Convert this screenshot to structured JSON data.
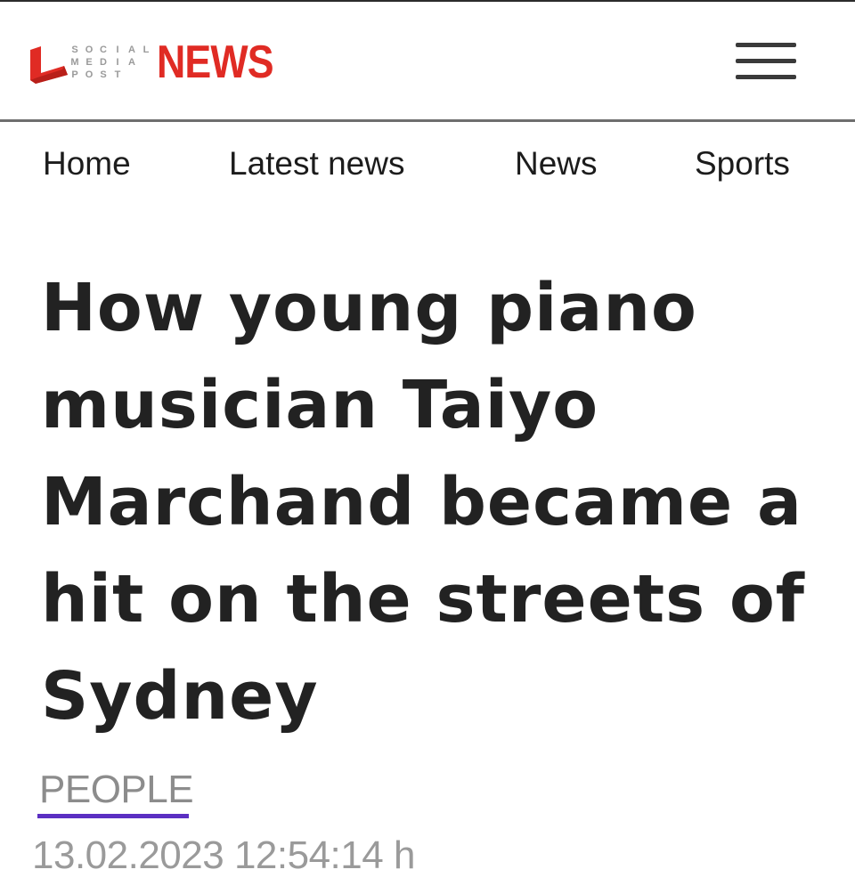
{
  "header": {
    "logo": {
      "letters": [
        "S",
        "O",
        "C",
        "I",
        "A",
        "L",
        "M",
        "E",
        "D",
        "I",
        "A",
        "",
        "P",
        "O",
        "S",
        "T",
        "",
        ""
      ],
      "wordmark": "NEWS",
      "brand_color": "#e02b24",
      "letters_color": "#9a9a9a"
    },
    "menu_icon": "hamburger-menu-icon"
  },
  "nav": {
    "items": [
      {
        "label": "Home"
      },
      {
        "label": "Latest news"
      },
      {
        "label": "News"
      },
      {
        "label": "Sports"
      }
    ]
  },
  "article": {
    "headline": "How young piano musician Taiyo Marchand became a hit on the streets of Sydney",
    "category": "PEOPLE",
    "category_accent": "#5b2fc2",
    "timestamp": "13.02.2023 12:54:14 h"
  }
}
